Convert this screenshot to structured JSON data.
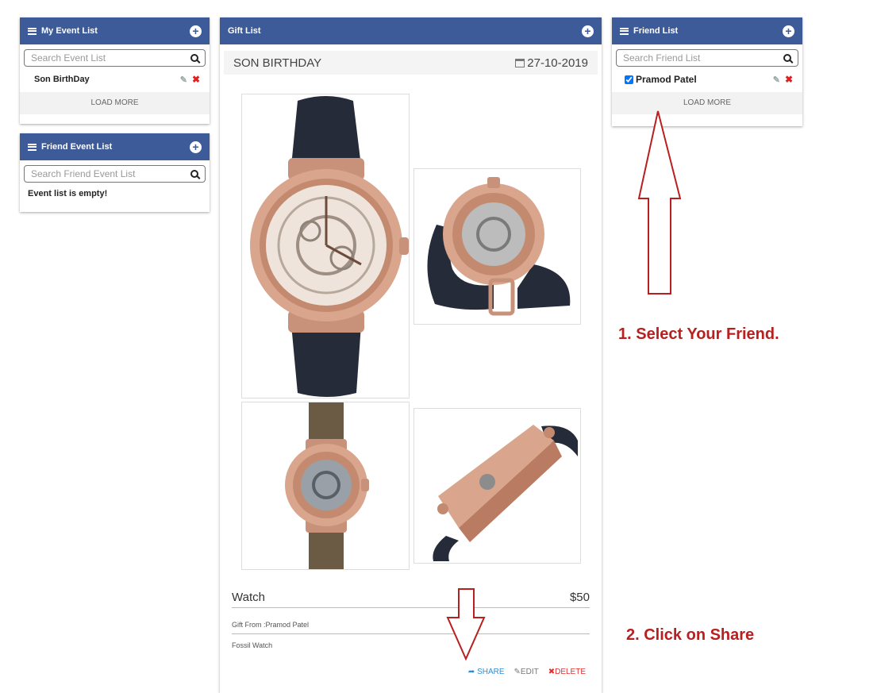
{
  "my_event_list": {
    "title": "My Event List",
    "search_placeholder": "Search Event List",
    "items": [
      {
        "label": "Son BirthDay"
      }
    ],
    "load_more": "LOAD MORE"
  },
  "friend_event_list": {
    "title": "Friend Event List",
    "search_placeholder": "Search Friend Event List",
    "empty_message": "Event list is empty!"
  },
  "gift_list": {
    "title": "Gift List",
    "event_name": "SON BIRTHDAY",
    "event_date": "27-10-2019",
    "gift": {
      "name": "Watch",
      "price": "$50",
      "from": "Gift From :Pramod Patel",
      "description": "Fossil Watch"
    },
    "actions": {
      "share": "SHARE",
      "edit": "EDIT",
      "delete": "DELETE"
    }
  },
  "friend_list": {
    "title": "Friend List",
    "search_placeholder": "Search Friend List",
    "items": [
      {
        "label": "Pramod Patel",
        "checked": true
      }
    ],
    "load_more": "LOAD MORE"
  },
  "annotations": {
    "step1": "1. Select Your Friend.",
    "step2": "2. Click on Share"
  },
  "colors": {
    "header_blue": "#3d5a99",
    "annotation_red": "#b82020",
    "share_blue": "#2b8fd6",
    "delete_red": "#e03030"
  }
}
